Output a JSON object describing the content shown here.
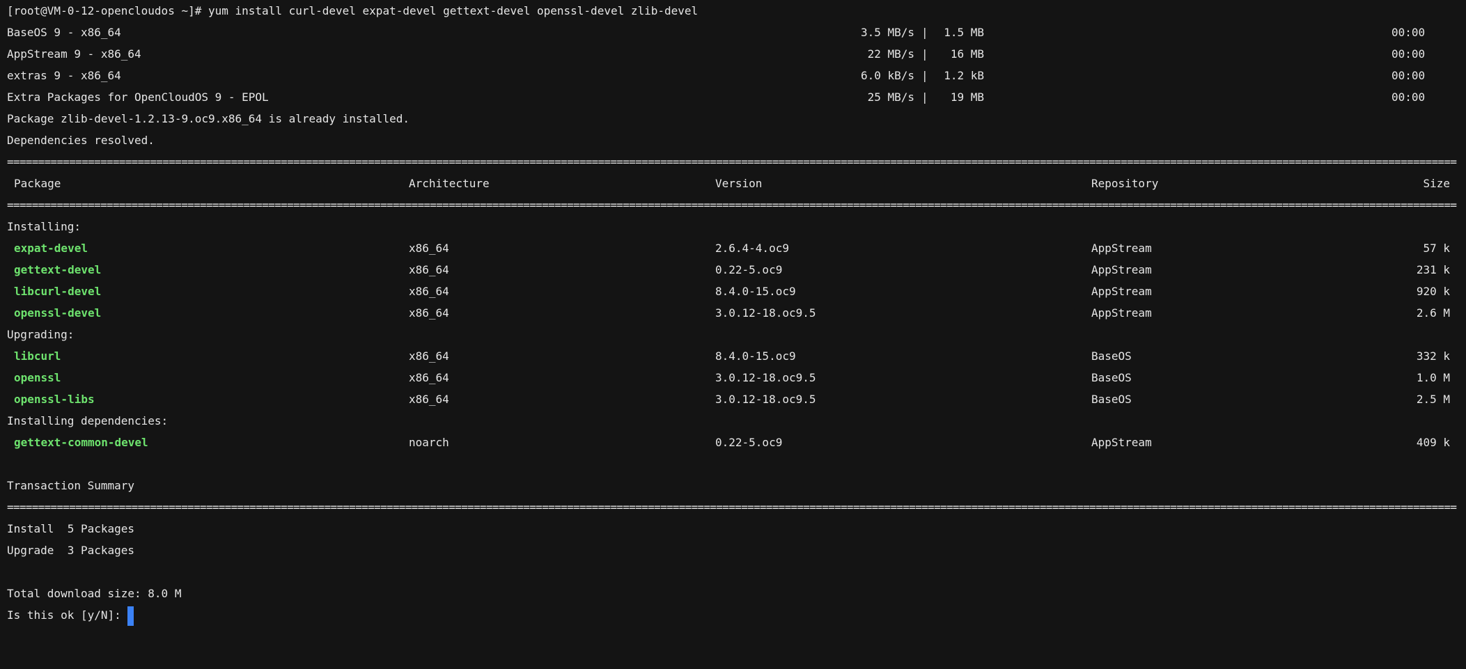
{
  "terminal": {
    "prompt_line": "[root@VM-0-12-opencloudos ~]# yum install curl-devel expat-devel gettext-devel openssl-devel zlib-devel",
    "repos": [
      {
        "name": "BaseOS 9 - x86_64",
        "speed": "3.5 MB/s",
        "size": "1.5 MB",
        "time": "00:00"
      },
      {
        "name": "AppStream 9 - x86_64",
        "speed": "22 MB/s",
        "size": "16 MB",
        "time": "00:00"
      },
      {
        "name": "extras 9 - x86_64",
        "speed": "6.0 kB/s",
        "size": "1.2 kB",
        "time": "00:00"
      },
      {
        "name": "Extra Packages for OpenCloudOS 9 - EPOL",
        "speed": "25 MB/s",
        "size": "19 MB",
        "time": "00:00"
      }
    ],
    "separator_char": "|",
    "already_installed": "Package zlib-devel-1.2.13-9.oc9.x86_64 is already installed.",
    "deps_resolved": "Dependencies resolved.",
    "rule": "===========================================================================================================================================================================================================================================================================",
    "table": {
      "headers": {
        "package": "Package",
        "arch": "Architecture",
        "version": "Version",
        "repo": "Repository",
        "size": "Size"
      },
      "sections": [
        {
          "title": "Installing:",
          "rows": [
            {
              "package": "expat-devel",
              "arch": "x86_64",
              "version": "2.6.4-4.oc9",
              "repo": "AppStream",
              "size": "57 k"
            },
            {
              "package": "gettext-devel",
              "arch": "x86_64",
              "version": "0.22-5.oc9",
              "repo": "AppStream",
              "size": "231 k"
            },
            {
              "package": "libcurl-devel",
              "arch": "x86_64",
              "version": "8.4.0-15.oc9",
              "repo": "AppStream",
              "size": "920 k"
            },
            {
              "package": "openssl-devel",
              "arch": "x86_64",
              "version": "3.0.12-18.oc9.5",
              "repo": "AppStream",
              "size": "2.6 M"
            }
          ]
        },
        {
          "title": "Upgrading:",
          "rows": [
            {
              "package": "libcurl",
              "arch": "x86_64",
              "version": "8.4.0-15.oc9",
              "repo": "BaseOS",
              "size": "332 k"
            },
            {
              "package": "openssl",
              "arch": "x86_64",
              "version": "3.0.12-18.oc9.5",
              "repo": "BaseOS",
              "size": "1.0 M"
            },
            {
              "package": "openssl-libs",
              "arch": "x86_64",
              "version": "3.0.12-18.oc9.5",
              "repo": "BaseOS",
              "size": "2.5 M"
            }
          ]
        },
        {
          "title": "Installing dependencies:",
          "rows": [
            {
              "package": "gettext-common-devel",
              "arch": "noarch",
              "version": "0.22-5.oc9",
              "repo": "AppStream",
              "size": "409 k"
            }
          ]
        }
      ]
    },
    "summary": {
      "title": "Transaction Summary",
      "install_line": "Install  5 Packages",
      "upgrade_line": "Upgrade  3 Packages",
      "total_download": "Total download size: 8.0 M",
      "confirm_prompt": "Is this ok [y/N]:"
    },
    "colors": {
      "background": "#141414",
      "text": "#e6e6e6",
      "package_name": "#6ee36e",
      "cursor": "#3b82f6"
    }
  }
}
